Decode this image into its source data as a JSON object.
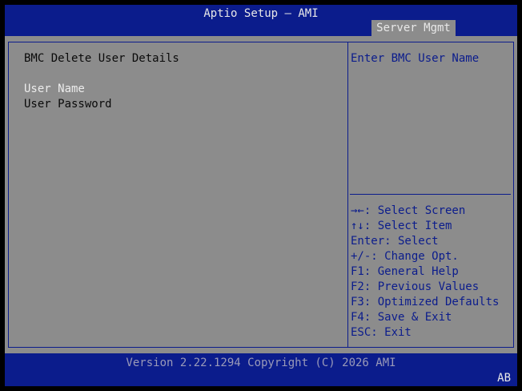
{
  "header": {
    "title": "Aptio Setup – AMI",
    "active_tab": "Server Mgmt"
  },
  "main": {
    "section_title": "BMC Delete User Details",
    "items": [
      {
        "label": "User Name",
        "selected": true
      },
      {
        "label": "User Password",
        "selected": false
      }
    ]
  },
  "help": {
    "text": "Enter BMC User Name",
    "keys": [
      "→←: Select Screen",
      "↑↓: Select Item",
      "Enter: Select",
      "+/-: Change Opt.",
      "F1: General Help",
      "F2: Previous Values",
      "F3: Optimized Defaults",
      "F4: Save & Exit",
      "ESC: Exit"
    ]
  },
  "footer": {
    "version": "Version 2.22.1294 Copyright (C) 2026 AMI",
    "badge": "AB"
  },
  "colors": {
    "background_gray": "#8c8c8c",
    "bar_blue": "#0b1c8c",
    "text_blue": "#0b1c8c",
    "text_white": "#ececec"
  }
}
